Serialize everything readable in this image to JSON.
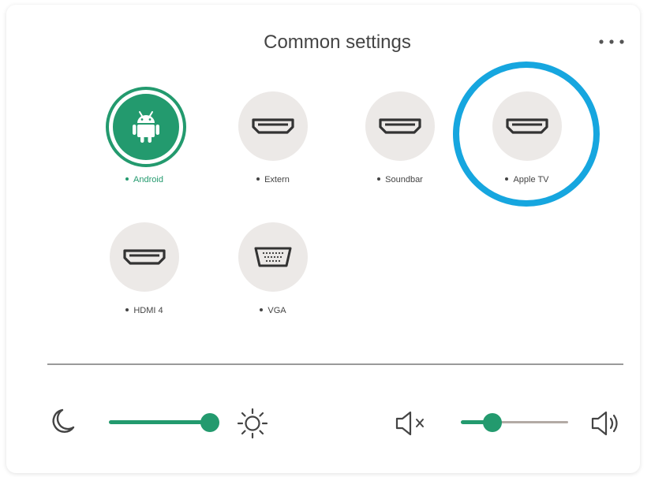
{
  "title": "Common settings",
  "sources": [
    {
      "label": "Android",
      "icon": "android-icon",
      "active": true
    },
    {
      "label": "Extern",
      "icon": "hdmi-icon",
      "active": false
    },
    {
      "label": "Soundbar",
      "icon": "hdmi-icon",
      "active": false
    },
    {
      "label": "Apple TV",
      "icon": "hdmi-icon",
      "active": false
    },
    {
      "label": "HDMI 4",
      "icon": "hdmi-icon",
      "active": false
    },
    {
      "label": "VGA",
      "icon": "vga-icon",
      "active": false
    }
  ],
  "brightness": {
    "level_percent": 100,
    "min_icon": "moon-icon",
    "max_icon": "sun-icon"
  },
  "volume": {
    "level_percent": 25,
    "min_icon": "mute-icon",
    "max_icon": "volume-icon"
  },
  "colors": {
    "accent": "#239a6e",
    "highlight_ring": "#16a6df",
    "tile": "#ece9e7"
  }
}
